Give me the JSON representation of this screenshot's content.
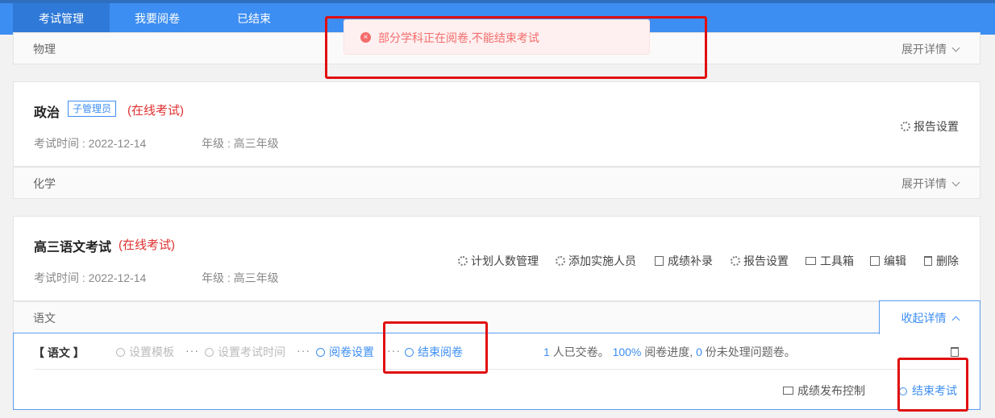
{
  "nav": {
    "tabs": [
      "考试管理",
      "我要阅卷",
      "已结束"
    ]
  },
  "alert": {
    "message": "部分学科正在阅卷,不能结束考试"
  },
  "subject_rows": [
    {
      "name": "物理",
      "expand": "展开详情"
    },
    {
      "name": "化学",
      "expand": "展开详情"
    }
  ],
  "exam_politics": {
    "title": "政治",
    "tag": "子管理员",
    "status": "(在线考试)",
    "time_label": "考试时间 : 2022-12-14",
    "grade_label": "年级 : 高三年级",
    "report_settings": "报告设置"
  },
  "exam_chinese": {
    "title": "高三语文考试",
    "status": "(在线考试)",
    "time_label": "考试时间 : 2022-12-14",
    "grade_label": "年级 : 高三年级",
    "actions": {
      "plan": "计划人数管理",
      "add": "添加实施人员",
      "supplement": "成绩补录",
      "report": "报告设置",
      "toolbox": "工具箱",
      "edit": "编辑",
      "delete": "删除"
    },
    "subject": "语文",
    "collapse": "收起详情",
    "detail": {
      "subject_bracket": "【 语文 】",
      "steps": [
        "设置模板",
        "设置考试时间",
        "阅卷设置",
        "结束阅卷"
      ],
      "submitted_count": "1",
      "submitted_text": "人已交卷。",
      "progress": "100%",
      "progress_text": "阅卷进度,",
      "problem_count": "0",
      "problem_text": "份未处理问题卷。",
      "publish_control": "成绩发布控制",
      "end_exam": "结束考试"
    }
  }
}
